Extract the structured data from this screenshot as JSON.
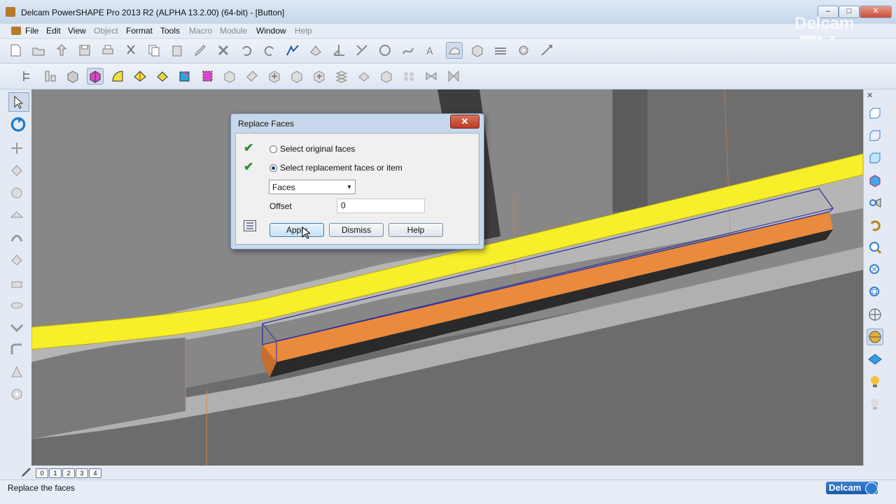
{
  "window": {
    "title": "Delcam PowerSHAPE Pro 2013 R2 (ALPHA 13.2.00) (64-bit) - [Button]",
    "minimize": "‒",
    "maximize": "□",
    "close": "✕"
  },
  "menu": [
    "File",
    "Edit",
    "View",
    "Object",
    "Format",
    "Tools",
    "Macro",
    "Module",
    "Window",
    "Help"
  ],
  "dialog": {
    "title": "Replace Faces",
    "close": "✕",
    "check_mark": "✔",
    "option1": "Select original faces",
    "option2": "Select replacement faces or item",
    "dropdown_value": "Faces",
    "offset_label": "Offset",
    "offset_value": "0",
    "apply": "Apply",
    "dismiss": "Dismiss",
    "help": "Help"
  },
  "levels": [
    "0",
    "1",
    "2",
    "3",
    "4"
  ],
  "status": {
    "message": "Replace the faces",
    "brand": "Delcam"
  },
  "watermark": {
    "line1": "Delcam",
    "line2": "TV"
  },
  "colors": {
    "yellow_band": "#f6ef2a",
    "orange_face": "#e98a3c",
    "selection_edge": "#2b2b9e"
  }
}
